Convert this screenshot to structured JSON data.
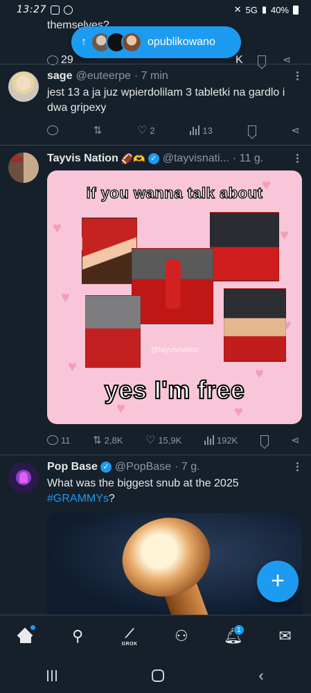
{
  "status_bar": {
    "time": "13:27",
    "battery": "40%",
    "network": "5G"
  },
  "toast": {
    "label": "opublikowano"
  },
  "prev_tweet": {
    "text_fragment": "themselves?",
    "replies": "29",
    "views": "K"
  },
  "tweets": [
    {
      "name": "sage",
      "handle": "@euteerpe",
      "time": "· 7 min",
      "text": "jest 13 a ja juz wpierdolilam 3 tabletki na gardlo i dwa gripexy",
      "replies": "",
      "retweets": "",
      "likes": "2",
      "views": "13"
    },
    {
      "name": "Tayvis Nation",
      "emoji": "🏈🫶",
      "handle": "@tayvisnati...",
      "time": "· 11 g.",
      "meme_top": "if you wanna talk about",
      "meme_bottom": "yes I'm free",
      "watermark": "@tayvisnation",
      "replies": "11",
      "retweets": "2,8K",
      "likes": "15,9K",
      "views": "192K"
    },
    {
      "name": "Pop Base",
      "handle": "@PopBase",
      "time": "· 7 g.",
      "text": "What was the biggest snub at the 2025",
      "hashtag": "#GRAMMYs",
      "text_end": "?"
    }
  ],
  "tabbar": {
    "grok_label": "GROK",
    "notifications_badge": "1"
  },
  "colors": {
    "background": "#15202b",
    "accent": "#1d9bf0",
    "muted": "#8b98a5",
    "divider": "#38444d"
  }
}
